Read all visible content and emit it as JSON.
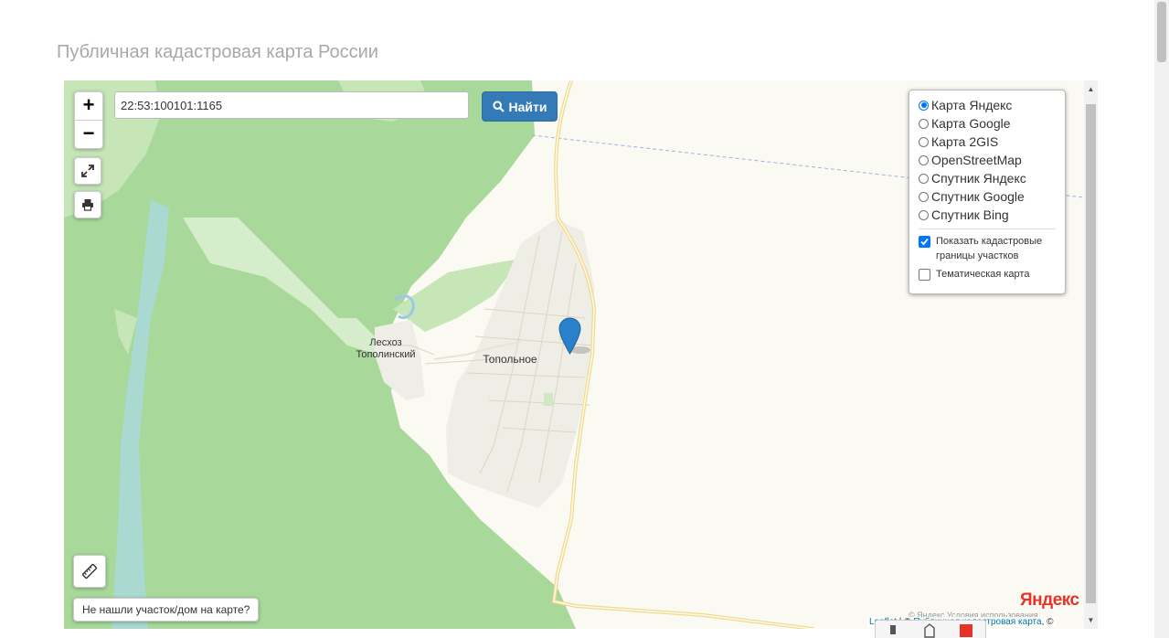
{
  "page": {
    "title": "Публичная кадастровая карта России"
  },
  "search": {
    "value": "22:53:100101:1165",
    "button_label": "Найти",
    "button_icon": "search-icon"
  },
  "controls": {
    "zoom_in": "+",
    "zoom_out": "−",
    "fullscreen_icon": "expand-icon",
    "print_icon": "printer-icon",
    "ruler_icon": "ruler-icon"
  },
  "layers": {
    "base": [
      {
        "label": "Карта Яндекс",
        "selected": true
      },
      {
        "label": "Карта Google",
        "selected": false
      },
      {
        "label": "Карта 2GIS",
        "selected": false
      },
      {
        "label": "OpenStreetMap",
        "selected": false
      },
      {
        "label": "Спутник Яндекс",
        "selected": false
      },
      {
        "label": "Спутник Google",
        "selected": false
      },
      {
        "label": "Спутник Bing",
        "selected": false
      }
    ],
    "overlays": [
      {
        "label": "Показать кадастровые границы участков",
        "checked": true
      },
      {
        "label": "Тематическая карта",
        "checked": false
      }
    ]
  },
  "map": {
    "places": [
      {
        "label": "Лесхоз Тополинский"
      },
      {
        "label": "Топольное"
      }
    ],
    "marker_icon": "map-pin-icon",
    "not_found_button": "Не нашли участок/дом на карте?",
    "provider_logo": "Яндекс",
    "provider_terms": "© Яндекс  Условия использования",
    "attribution": {
      "leaflet": "Leaflet",
      "separator": " | © ",
      "source": "Публичная кадастровая карта",
      "suffix": ", ©"
    }
  },
  "colors": {
    "forest": "#a8d99a",
    "forest_light": "#c6e6b8",
    "water": "#a9d9d0",
    "land": "#fbfaf2",
    "road": "#f3d98a",
    "settlement": "#efeee6",
    "marker": "#2a81cb",
    "button": "#337ab7"
  }
}
